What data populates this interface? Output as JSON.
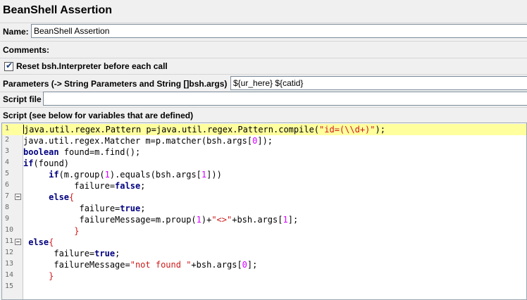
{
  "title": "BeanShell Assertion",
  "name": {
    "label": "Name:",
    "value": "BeanShell Assertion"
  },
  "comments": {
    "label": "Comments:"
  },
  "reset": {
    "label": "Reset bsh.Interpreter before each call",
    "checked": true
  },
  "parameters": {
    "label": "Parameters (-> String Parameters and String []bsh.args)",
    "value": "${ur_here} ${catid}"
  },
  "script_file": {
    "label": "Script file",
    "value": ""
  },
  "script": {
    "label": "Script (see below for variables that are defined)"
  },
  "editor": {
    "current_line": 1,
    "lines": [
      {
        "n": "1",
        "fold": false,
        "segs": [
          {
            "t": "java.util.regex.Pattern p=java.util.regex.Pattern.compile(",
            "c": "txt"
          },
          {
            "t": "\"id=(\\\\d+)\"",
            "c": "str"
          },
          {
            "t": ");",
            "c": "txt"
          }
        ]
      },
      {
        "n": "2",
        "fold": false,
        "segs": [
          {
            "t": "java.util.regex.Matcher m=p.matcher(bsh.args[",
            "c": "txt"
          },
          {
            "t": "0",
            "c": "num"
          },
          {
            "t": "]);",
            "c": "txt"
          }
        ]
      },
      {
        "n": "3",
        "fold": false,
        "segs": [
          {
            "t": "boolean",
            "c": "kw2"
          },
          {
            "t": " found=m.find();",
            "c": "txt"
          }
        ]
      },
      {
        "n": "4",
        "fold": false,
        "segs": [
          {
            "t": "if",
            "c": "kw2"
          },
          {
            "t": "(found)",
            "c": "txt"
          }
        ]
      },
      {
        "n": "5",
        "fold": false,
        "segs": [
          {
            "t": "     ",
            "c": "txt"
          },
          {
            "t": "if",
            "c": "kw2"
          },
          {
            "t": "(m.group(",
            "c": "txt"
          },
          {
            "t": "1",
            "c": "num"
          },
          {
            "t": ").equals(bsh.args[",
            "c": "txt"
          },
          {
            "t": "1",
            "c": "num"
          },
          {
            "t": "]))",
            "c": "txt"
          }
        ]
      },
      {
        "n": "6",
        "fold": false,
        "segs": [
          {
            "t": "          failure=",
            "c": "txt"
          },
          {
            "t": "false",
            "c": "kw2"
          },
          {
            "t": ";",
            "c": "txt"
          }
        ]
      },
      {
        "n": "7",
        "fold": true,
        "segs": [
          {
            "t": "     ",
            "c": "txt"
          },
          {
            "t": "else",
            "c": "kw2"
          },
          {
            "t": "{",
            "c": "brk"
          }
        ]
      },
      {
        "n": "8",
        "fold": false,
        "segs": [
          {
            "t": "           failure=",
            "c": "txt"
          },
          {
            "t": "true",
            "c": "kw2"
          },
          {
            "t": ";",
            "c": "txt"
          }
        ]
      },
      {
        "n": "9",
        "fold": false,
        "segs": [
          {
            "t": "           failureMessage=m.proup(",
            "c": "txt"
          },
          {
            "t": "1",
            "c": "num"
          },
          {
            "t": ")+",
            "c": "txt"
          },
          {
            "t": "\"<>\"",
            "c": "str"
          },
          {
            "t": "+bsh.args[",
            "c": "txt"
          },
          {
            "t": "1",
            "c": "num"
          },
          {
            "t": "];",
            "c": "txt"
          }
        ]
      },
      {
        "n": "10",
        "fold": false,
        "segs": [
          {
            "t": "          ",
            "c": "txt"
          },
          {
            "t": "}",
            "c": "brk"
          }
        ]
      },
      {
        "n": "11",
        "fold": true,
        "segs": [
          {
            "t": " ",
            "c": "txt"
          },
          {
            "t": "else",
            "c": "kw2"
          },
          {
            "t": "{",
            "c": "brk"
          }
        ]
      },
      {
        "n": "12",
        "fold": false,
        "segs": [
          {
            "t": "      failure=",
            "c": "txt"
          },
          {
            "t": "true",
            "c": "kw2"
          },
          {
            "t": ";",
            "c": "txt"
          }
        ]
      },
      {
        "n": "13",
        "fold": false,
        "segs": [
          {
            "t": "      failureMessage=",
            "c": "txt"
          },
          {
            "t": "\"not found \"",
            "c": "str"
          },
          {
            "t": "+bsh.args[",
            "c": "txt"
          },
          {
            "t": "0",
            "c": "num"
          },
          {
            "t": "];",
            "c": "txt"
          }
        ]
      },
      {
        "n": "14",
        "fold": false,
        "segs": [
          {
            "t": "     ",
            "c": "txt"
          },
          {
            "t": "}",
            "c": "brk"
          }
        ]
      },
      {
        "n": "15",
        "fold": false,
        "segs": []
      }
    ]
  }
}
